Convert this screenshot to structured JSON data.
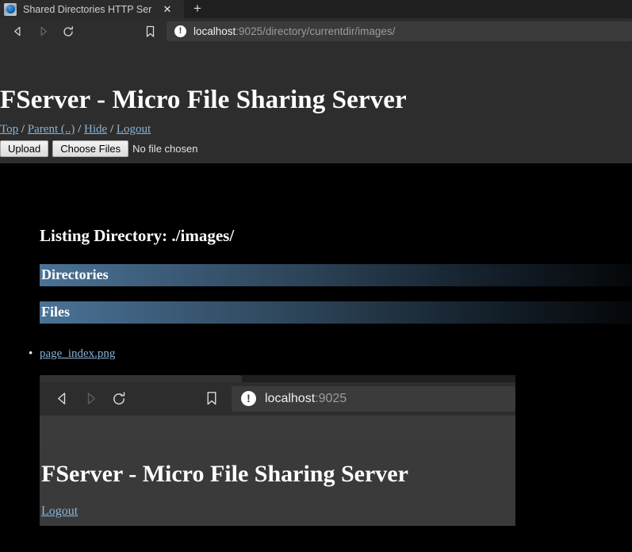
{
  "browser": {
    "tab": {
      "favicon": "drive-globe-icon",
      "title": "Shared Directories HTTP Ser",
      "close_label": "✕"
    },
    "new_tab_label": "+",
    "nav": {
      "back_icon": "back-arrow-icon",
      "forward_icon": "forward-arrow-icon",
      "reload_icon": "reload-icon",
      "bookmark_icon": "bookmark-icon"
    },
    "address": {
      "security_icon": "info-circle-icon",
      "security_glyph": "!",
      "host": "localhost",
      "path": ":9025/directory/currentdir/images/",
      "full_url": "localhost:9025/directory/currentdir/images/"
    }
  },
  "page": {
    "title": "FServer - Micro File Sharing Server",
    "nav_links": [
      {
        "label": "Top"
      },
      {
        "label": "Parent (..)"
      },
      {
        "label": "Hide"
      },
      {
        "label": "Logout"
      }
    ],
    "nav_separator": "/",
    "upload": {
      "upload_button": "Upload",
      "choose_button": "Choose Files",
      "file_status": "No file chosen"
    },
    "listing_heading": "Listing Directory: ./images/",
    "sections": [
      {
        "name": "directories",
        "label": "Directories",
        "items": []
      },
      {
        "name": "files",
        "label": "Files",
        "items": [
          {
            "label": "page_index.png"
          }
        ]
      }
    ]
  },
  "preview": {
    "alt": "page_index.png",
    "nav": {
      "back_icon": "back-arrow-icon",
      "forward_icon": "forward-arrow-icon",
      "reload_icon": "reload-icon",
      "bookmark_icon": "bookmark-icon"
    },
    "address": {
      "security_glyph": "!",
      "host": "localhost",
      "path": ":9025",
      "full_url": "localhost:9025"
    },
    "title": "FServer - Micro File Sharing Server",
    "logout_label": "Logout"
  },
  "colors": {
    "page_background": "#000000",
    "chrome_background": "#2d2d2d",
    "tabstrip_background": "#1f1f1f",
    "link": "#8ab4d8",
    "section_header_start": "#4a7296",
    "section_header_end": "#050709",
    "text": "#ffffff"
  }
}
